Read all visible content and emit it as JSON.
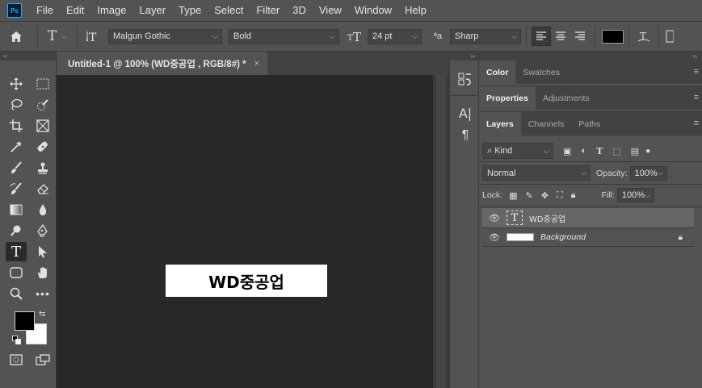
{
  "menu": [
    "File",
    "Edit",
    "Image",
    "Layer",
    "Type",
    "Select",
    "Filter",
    "3D",
    "View",
    "Window",
    "Help"
  ],
  "app_logo": "Ps",
  "options": {
    "font_family": "Malgun Gothic",
    "font_style": "Bold",
    "font_size": "24 pt",
    "antialias_label": "ªa",
    "antialias": "Sharp",
    "text_color": "#000000"
  },
  "document": {
    "tab_title": "Untitled-1 @ 100% (WD중공업 , RGB/8#) *",
    "close": "×",
    "canvas_text": "WD중공업"
  },
  "panels": {
    "color_tabs": [
      "Color",
      "Swatches"
    ],
    "properties_tabs": [
      "Properties",
      "Adjustments"
    ],
    "layers_tabs": [
      "Layers",
      "Channels",
      "Paths"
    ],
    "filter_kind": "Kind",
    "blend_mode": "Normal",
    "opacity_label": "Opacity:",
    "opacity_value": "100%",
    "lock_label": "Lock:",
    "fill_label": "Fill:",
    "fill_value": "100%",
    "layers": [
      {
        "name": "WD중공업",
        "type": "text",
        "selected": true
      },
      {
        "name": "Background",
        "type": "background",
        "selected": false
      }
    ]
  },
  "colors": {
    "foreground": "#000000",
    "background": "#ffffff",
    "accent": "#31a8ff"
  }
}
